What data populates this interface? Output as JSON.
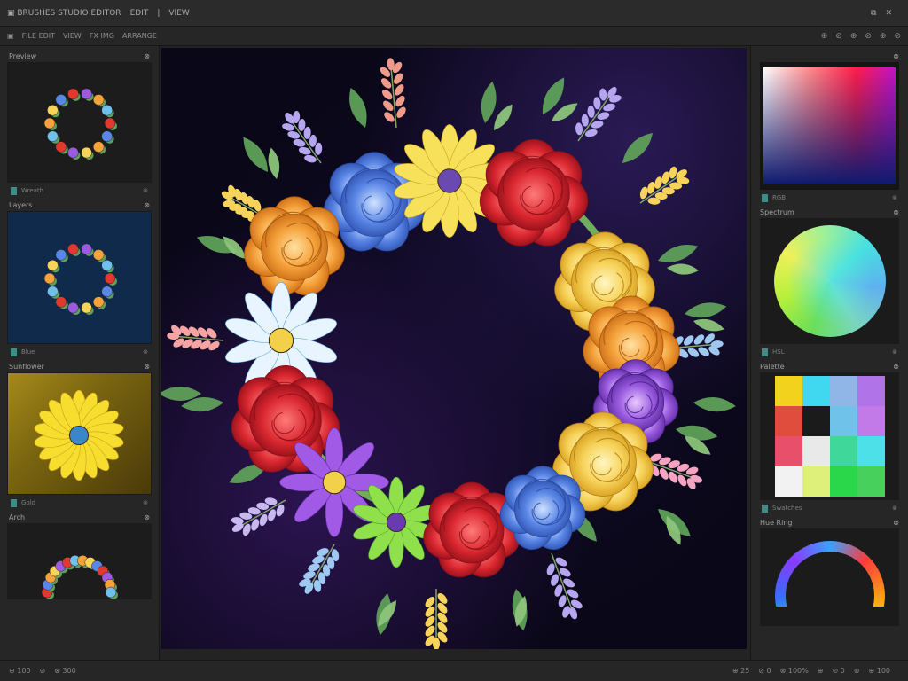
{
  "titlebar": {
    "items": [
      "▣ BRUSHES STUDIO EDITOR",
      "EDIT",
      "|",
      "VIEW"
    ],
    "icons": [
      "⧉",
      "✕"
    ]
  },
  "toolbar": {
    "items": [
      "▣",
      "FILE EDIT",
      "VIEW",
      "FX IMG",
      "ARRANGE"
    ],
    "icons": [
      "⊕",
      "⊘",
      "⊕",
      "⊘",
      "⊕",
      "⊘"
    ]
  },
  "left_panel": {
    "sections": [
      {
        "header": "Preview",
        "icon": "⊗",
        "footer": "Wreath",
        "footer_icon": "⊗",
        "bg": "#1c1c1c"
      },
      {
        "header": "Layers",
        "icon": "⊗",
        "footer": "Blue",
        "footer_icon": "⊗",
        "bg": "#0f2a4a"
      },
      {
        "header": "Sunflower",
        "icon": "⊗",
        "footer": "Gold",
        "footer_icon": "⊗",
        "bg": "#7a6510"
      },
      {
        "header": "Arch",
        "icon": "⊗",
        "footer": "",
        "footer_icon": "",
        "bg": "#1c1c1c"
      }
    ]
  },
  "right_panel": {
    "sections": [
      {
        "header": "",
        "icon": "⊗",
        "footer": "RGB",
        "footer_icon": "⊗"
      },
      {
        "header": "Spectrum",
        "icon": "⊗",
        "footer": "HSL",
        "footer_icon": "⊗"
      },
      {
        "header": "Palette",
        "icon": "⊗",
        "footer": "Swatches",
        "footer_icon": "⊗"
      },
      {
        "header": "Hue Ring",
        "icon": "⊗",
        "footer": "",
        "footer_icon": ""
      }
    ],
    "palette": [
      "#f2d21c",
      "#3fd8f0",
      "#8fb6e6",
      "#b073e8",
      "#e04d3d",
      "#1b1b1b",
      "#6fc3ea",
      "#c27ae8",
      "#e84f6a",
      "#e9e9e9",
      "#3fd89a",
      "#4de0e8",
      "#f2f2f2",
      "#dff07a",
      "#2ad64a",
      "#47d15c"
    ]
  },
  "statusbar": {
    "items": [
      "⊕ 100",
      "⊘",
      "⊗ 300"
    ],
    "right": [
      "⊕ 25",
      "⊘ 0",
      "⊗ 100%",
      "⊕",
      "⊘ 0",
      "⊗",
      "⊕ 100"
    ]
  },
  "canvas": {
    "title": "Wreath",
    "background": "#0d0920"
  }
}
